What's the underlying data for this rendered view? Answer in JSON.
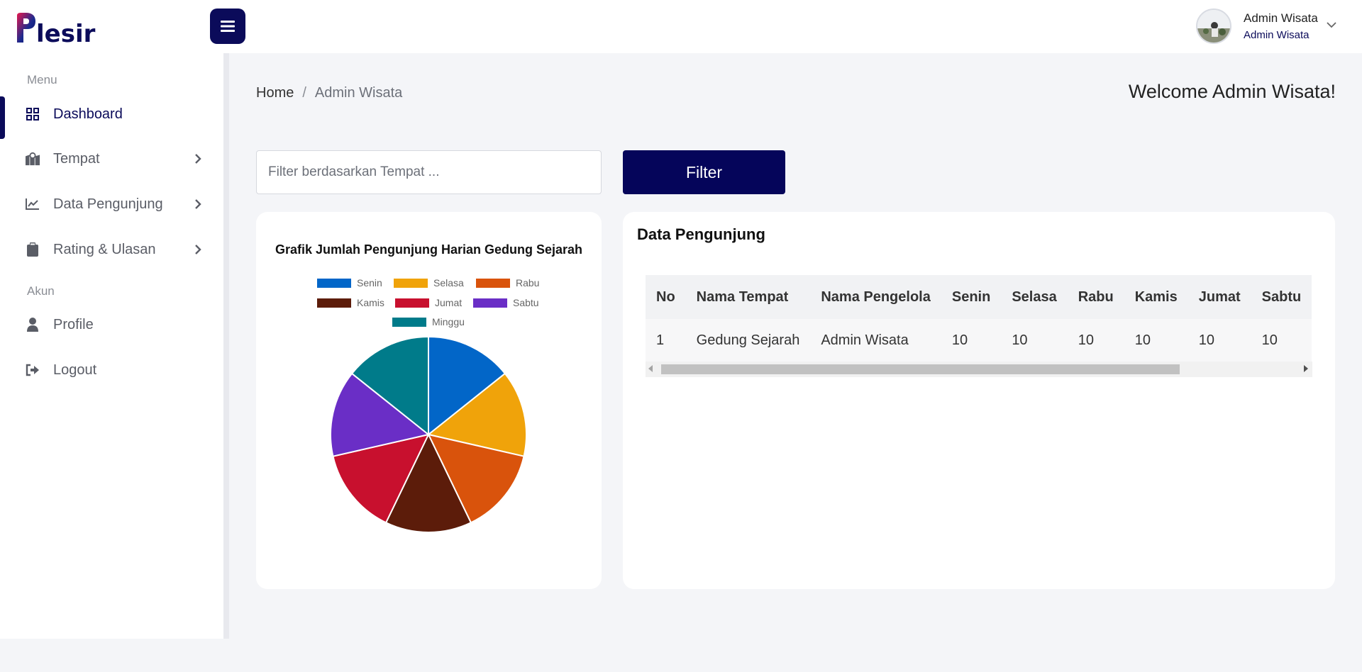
{
  "header": {
    "logo_text": "Plesir",
    "user_name": "Admin Wisata",
    "user_role": "Admin Wisata"
  },
  "sidebar": {
    "menu_heading": "Menu",
    "account_heading": "Akun",
    "items": [
      {
        "label": "Dashboard",
        "icon": "grid-icon"
      },
      {
        "label": "Tempat",
        "icon": "map-icon"
      },
      {
        "label": "Data Pengunjung",
        "icon": "line-chart-icon"
      },
      {
        "label": "Rating & Ulasan",
        "icon": "clipboard-icon"
      },
      {
        "label": "Profile",
        "icon": "user-icon"
      },
      {
        "label": "Logout",
        "icon": "logout-icon"
      }
    ]
  },
  "breadcrumb": {
    "home": "Home",
    "separator": "/",
    "current": "Admin Wisata"
  },
  "welcome": "Welcome Admin Wisata!",
  "filter": {
    "placeholder": "Filter berdasarkan Tempat ...",
    "button_label": "Filter"
  },
  "chart_data": {
    "type": "pie",
    "title": "Grafik Jumlah Pengunjung Harian Gedung Sejarah",
    "legend_position": "top",
    "categories": [
      "Senin",
      "Selasa",
      "Rabu",
      "Kamis",
      "Jumat",
      "Sabtu",
      "Minggu"
    ],
    "values": [
      10,
      10,
      10,
      10,
      10,
      10,
      10
    ],
    "colors": [
      "#0266c8",
      "#f0a30a",
      "#d9530c",
      "#5c1c0a",
      "#c8102e",
      "#6a2ec6",
      "#007b8a"
    ]
  },
  "table": {
    "title": "Data Pengunjung",
    "columns": [
      "No",
      "Nama Tempat",
      "Nama Pengelola",
      "Senin",
      "Selasa",
      "Rabu",
      "Kamis",
      "Jumat",
      "Sabtu"
    ],
    "rows": [
      [
        "1",
        "Gedung Sejarah",
        "Admin Wisata",
        "10",
        "10",
        "10",
        "10",
        "10",
        "10"
      ]
    ]
  },
  "colors": {
    "brand": "#0b0b5a",
    "background": "#f4f5f8"
  }
}
